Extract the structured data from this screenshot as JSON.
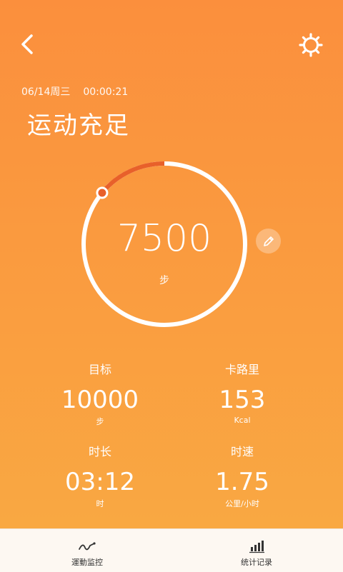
{
  "header": {
    "date": "06/14周三",
    "elapsed": "00:00:21",
    "status": "运动充足"
  },
  "ring": {
    "steps": "7500",
    "unit": "步",
    "progress_fraction": 0.14
  },
  "stats": {
    "goal": {
      "label": "目标",
      "value": "10000",
      "unit": "步"
    },
    "calories": {
      "label": "卡路里",
      "value": "153",
      "unit": "Kcal"
    },
    "duration": {
      "label": "时长",
      "value": "03:12",
      "unit": "时"
    },
    "speed": {
      "label": "时速",
      "value": "1.75",
      "unit": "公里/小时"
    }
  },
  "tabs": {
    "monitor": {
      "label": "運動监控",
      "icon": "sport-monitor-icon"
    },
    "records": {
      "label": "统计记录",
      "icon": "bar-chart-icon"
    }
  },
  "colors": {
    "background_top": "#fb8f3d",
    "background_bottom": "#f9a842",
    "progress_arc": "#e8602a",
    "tabbar": "#fdf8f2"
  }
}
